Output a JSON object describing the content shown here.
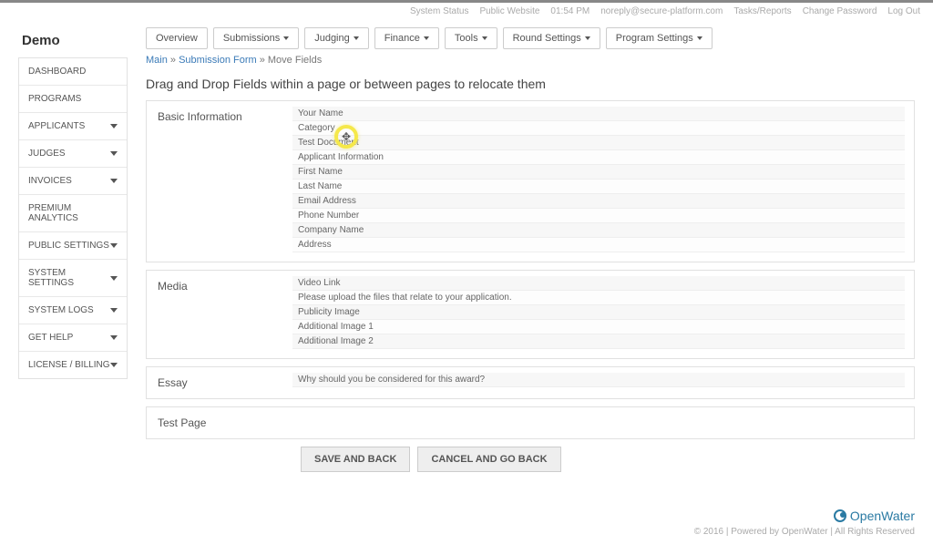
{
  "topbar": {
    "system_status": "System Status",
    "public_website": "Public Website",
    "time": "01:54 PM",
    "email": "noreply@secure-platform.com",
    "tasks": "Tasks/Reports",
    "change_pw": "Change Password",
    "logout": "Log Out"
  },
  "brand": "Demo",
  "sidebar": [
    {
      "label": "DASHBOARD",
      "caret": false
    },
    {
      "label": "PROGRAMS",
      "caret": false
    },
    {
      "label": "APPLICANTS",
      "caret": true
    },
    {
      "label": "JUDGES",
      "caret": true
    },
    {
      "label": "INVOICES",
      "caret": true
    },
    {
      "label": "PREMIUM ANALYTICS",
      "caret": false
    },
    {
      "label": "PUBLIC SETTINGS",
      "caret": true
    },
    {
      "label": "SYSTEM SETTINGS",
      "caret": true
    },
    {
      "label": "SYSTEM LOGS",
      "caret": true
    },
    {
      "label": "GET HELP",
      "caret": true
    },
    {
      "label": "LICENSE / BILLING",
      "caret": true
    }
  ],
  "tabs": [
    {
      "label": "Overview",
      "caret": false
    },
    {
      "label": "Submissions",
      "caret": true
    },
    {
      "label": "Judging",
      "caret": true
    },
    {
      "label": "Finance",
      "caret": true
    },
    {
      "label": "Tools",
      "caret": true
    },
    {
      "label": "Round Settings",
      "caret": true
    },
    {
      "label": "Program Settings",
      "caret": true
    }
  ],
  "crumbs": {
    "main": "Main",
    "sep": " » ",
    "sub": "Submission Form",
    "current": "Move Fields"
  },
  "page_title": "Drag and Drop Fields within a page or between pages to relocate them",
  "sections": [
    {
      "name": "Basic Information",
      "fields": [
        "Your Name",
        "Category",
        "Test Document",
        "Applicant Information",
        "First Name",
        "Last Name",
        "Email Address",
        "Phone Number",
        "Company Name",
        "Address"
      ]
    },
    {
      "name": "Media",
      "fields": [
        "Video Link",
        "Please upload the files that relate to your application.",
        "Publicity Image",
        "Additional Image 1",
        "Additional Image 2"
      ]
    },
    {
      "name": "Essay",
      "fields": [
        "Why should you be considered for this award?"
      ]
    },
    {
      "name": "Test Page",
      "fields": []
    }
  ],
  "buttons": {
    "save": "SAVE AND BACK",
    "cancel": "CANCEL AND GO BACK"
  },
  "footer": {
    "brand": "OpenWater",
    "copy": "© 2016 | Powered by OpenWater | All Rights Reserved"
  }
}
